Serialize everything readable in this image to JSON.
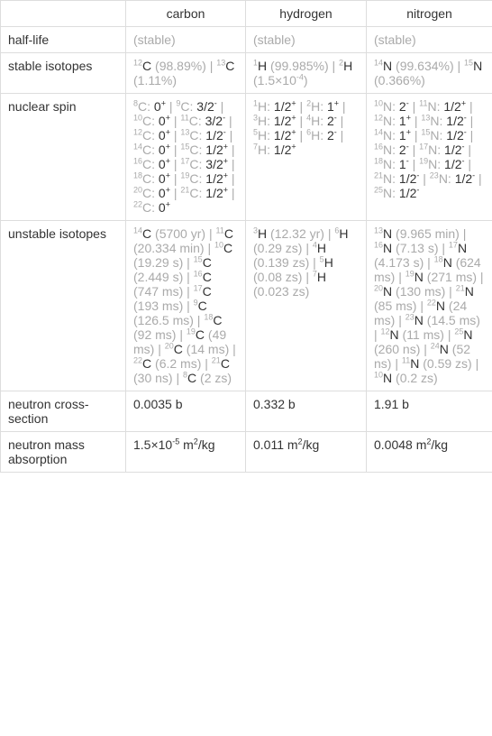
{
  "headers": {
    "c": "carbon",
    "h": "hydrogen",
    "n": "nitrogen"
  },
  "rows": {
    "halflife": {
      "label": "half-life",
      "c": "(stable)",
      "h": "(stable)",
      "n": "(stable)"
    },
    "stable": {
      "label": "stable isotopes",
      "c": [
        {
          "pre": "12",
          "sym": "C",
          "post": " (98.89%)"
        },
        {
          "pre": "13",
          "sym": "C",
          "post": " (1.11%)"
        }
      ],
      "h": [
        {
          "pre": "1",
          "sym": "H",
          "post": " (99.985%)"
        },
        {
          "pre": "2",
          "sym": "H",
          "post": " (1.5×10",
          "exp": "-4",
          "tail": ")"
        }
      ],
      "n": [
        {
          "pre": "14",
          "sym": "N",
          "post": " (99.634%)"
        },
        {
          "pre": "15",
          "sym": "N",
          "post": " (0.366%)"
        }
      ]
    },
    "spin": {
      "label": "nuclear spin",
      "c": [
        {
          "pre": "8",
          "sym": "C",
          "spin": "0",
          "sign": "+"
        },
        {
          "pre": "9",
          "sym": "C",
          "spin": "3/2",
          "sign": "-"
        },
        {
          "pre": "10",
          "sym": "C",
          "spin": "0",
          "sign": "+"
        },
        {
          "pre": "11",
          "sym": "C",
          "spin": "3/2",
          "sign": "-"
        },
        {
          "pre": "12",
          "sym": "C",
          "spin": "0",
          "sign": "+"
        },
        {
          "pre": "13",
          "sym": "C",
          "spin": "1/2",
          "sign": "-"
        },
        {
          "pre": "14",
          "sym": "C",
          "spin": "0",
          "sign": "+"
        },
        {
          "pre": "15",
          "sym": "C",
          "spin": "1/2",
          "sign": "+"
        },
        {
          "pre": "16",
          "sym": "C",
          "spin": "0",
          "sign": "+"
        },
        {
          "pre": "17",
          "sym": "C",
          "spin": "3/2",
          "sign": "+"
        },
        {
          "pre": "18",
          "sym": "C",
          "spin": "0",
          "sign": "+"
        },
        {
          "pre": "19",
          "sym": "C",
          "spin": "1/2",
          "sign": "+"
        },
        {
          "pre": "20",
          "sym": "C",
          "spin": "0",
          "sign": "+"
        },
        {
          "pre": "21",
          "sym": "C",
          "spin": "1/2",
          "sign": "+"
        },
        {
          "pre": "22",
          "sym": "C",
          "spin": "0",
          "sign": "+"
        }
      ],
      "h": [
        {
          "pre": "1",
          "sym": "H",
          "spin": "1/2",
          "sign": "+"
        },
        {
          "pre": "2",
          "sym": "H",
          "spin": "1",
          "sign": "+"
        },
        {
          "pre": "3",
          "sym": "H",
          "spin": "1/2",
          "sign": "+"
        },
        {
          "pre": "4",
          "sym": "H",
          "spin": "2",
          "sign": "-"
        },
        {
          "pre": "5",
          "sym": "H",
          "spin": "1/2",
          "sign": "+"
        },
        {
          "pre": "6",
          "sym": "H",
          "spin": "2",
          "sign": "-"
        },
        {
          "pre": "7",
          "sym": "H",
          "spin": "1/2",
          "sign": "+"
        }
      ],
      "n": [
        {
          "pre": "10",
          "sym": "N",
          "spin": "2",
          "sign": "-"
        },
        {
          "pre": "11",
          "sym": "N",
          "spin": "1/2",
          "sign": "+"
        },
        {
          "pre": "12",
          "sym": "N",
          "spin": "1",
          "sign": "+"
        },
        {
          "pre": "13",
          "sym": "N",
          "spin": "1/2",
          "sign": "-"
        },
        {
          "pre": "14",
          "sym": "N",
          "spin": "1",
          "sign": "+"
        },
        {
          "pre": "15",
          "sym": "N",
          "spin": "1/2",
          "sign": "-"
        },
        {
          "pre": "16",
          "sym": "N",
          "spin": "2",
          "sign": "-"
        },
        {
          "pre": "17",
          "sym": "N",
          "spin": "1/2",
          "sign": "-"
        },
        {
          "pre": "18",
          "sym": "N",
          "spin": "1",
          "sign": "-"
        },
        {
          "pre": "19",
          "sym": "N",
          "spin": "1/2",
          "sign": "-"
        },
        {
          "pre": "21",
          "sym": "N",
          "spin": "1/2",
          "sign": "-"
        },
        {
          "pre": "23",
          "sym": "N",
          "spin": "1/2",
          "sign": "-"
        },
        {
          "pre": "25",
          "sym": "N",
          "spin": "1/2",
          "sign": "-"
        }
      ]
    },
    "unstable": {
      "label": "unstable isotopes",
      "c": [
        {
          "pre": "14",
          "sym": "C",
          "post": " (5700 yr)"
        },
        {
          "pre": "11",
          "sym": "C",
          "post": " (20.334 min)"
        },
        {
          "pre": "10",
          "sym": "C",
          "post": " (19.29 s)"
        },
        {
          "pre": "15",
          "sym": "C",
          "post": " (2.449 s)"
        },
        {
          "pre": "16",
          "sym": "C",
          "post": " (747 ms)"
        },
        {
          "pre": "17",
          "sym": "C",
          "post": " (193 ms)"
        },
        {
          "pre": "9",
          "sym": "C",
          "post": " (126.5 ms)"
        },
        {
          "pre": "18",
          "sym": "C",
          "post": " (92 ms)"
        },
        {
          "pre": "19",
          "sym": "C",
          "post": " (49 ms)"
        },
        {
          "pre": "20",
          "sym": "C",
          "post": " (14 ms)"
        },
        {
          "pre": "22",
          "sym": "C",
          "post": " (6.2 ms)"
        },
        {
          "pre": "21",
          "sym": "C",
          "post": " (30 ns)"
        },
        {
          "pre": "8",
          "sym": "C",
          "post": " (2 zs)"
        }
      ],
      "h": [
        {
          "pre": "3",
          "sym": "H",
          "post": " (12.32 yr)"
        },
        {
          "pre": "6",
          "sym": "H",
          "post": " (0.29 zs)"
        },
        {
          "pre": "4",
          "sym": "H",
          "post": " (0.139 zs)"
        },
        {
          "pre": "5",
          "sym": "H",
          "post": " (0.08 zs)"
        },
        {
          "pre": "7",
          "sym": "H",
          "post": " (0.023 zs)"
        }
      ],
      "n": [
        {
          "pre": "13",
          "sym": "N",
          "post": " (9.965 min)"
        },
        {
          "pre": "16",
          "sym": "N",
          "post": " (7.13 s)"
        },
        {
          "pre": "17",
          "sym": "N",
          "post": " (4.173 s)"
        },
        {
          "pre": "18",
          "sym": "N",
          "post": " (624 ms)"
        },
        {
          "pre": "19",
          "sym": "N",
          "post": " (271 ms)"
        },
        {
          "pre": "20",
          "sym": "N",
          "post": " (130 ms)"
        },
        {
          "pre": "21",
          "sym": "N",
          "post": " (85 ms)"
        },
        {
          "pre": "22",
          "sym": "N",
          "post": " (24 ms)"
        },
        {
          "pre": "23",
          "sym": "N",
          "post": " (14.5 ms)"
        },
        {
          "pre": "12",
          "sym": "N",
          "post": " (11 ms)"
        },
        {
          "pre": "25",
          "sym": "N",
          "post": " (260 ns)"
        },
        {
          "pre": "24",
          "sym": "N",
          "post": " (52 ns)"
        },
        {
          "pre": "11",
          "sym": "N",
          "post": " (0.59 zs)"
        },
        {
          "pre": "10",
          "sym": "N",
          "post": " (0.2 zs)"
        }
      ]
    },
    "xsection": {
      "label": "neutron cross-section",
      "c": "0.0035 b",
      "h": "0.332 b",
      "n": "1.91 b"
    },
    "massabs": {
      "label": "neutron mass absorption",
      "c": {
        "text": "1.5×10",
        "exp": "-5",
        "tail": " m",
        "exp2": "2",
        "tail2": "/kg"
      },
      "h": {
        "text": "0.011 m",
        "exp": "2",
        "tail": "/kg"
      },
      "n": {
        "text": "0.0048 m",
        "exp": "2",
        "tail": "/kg"
      }
    }
  }
}
